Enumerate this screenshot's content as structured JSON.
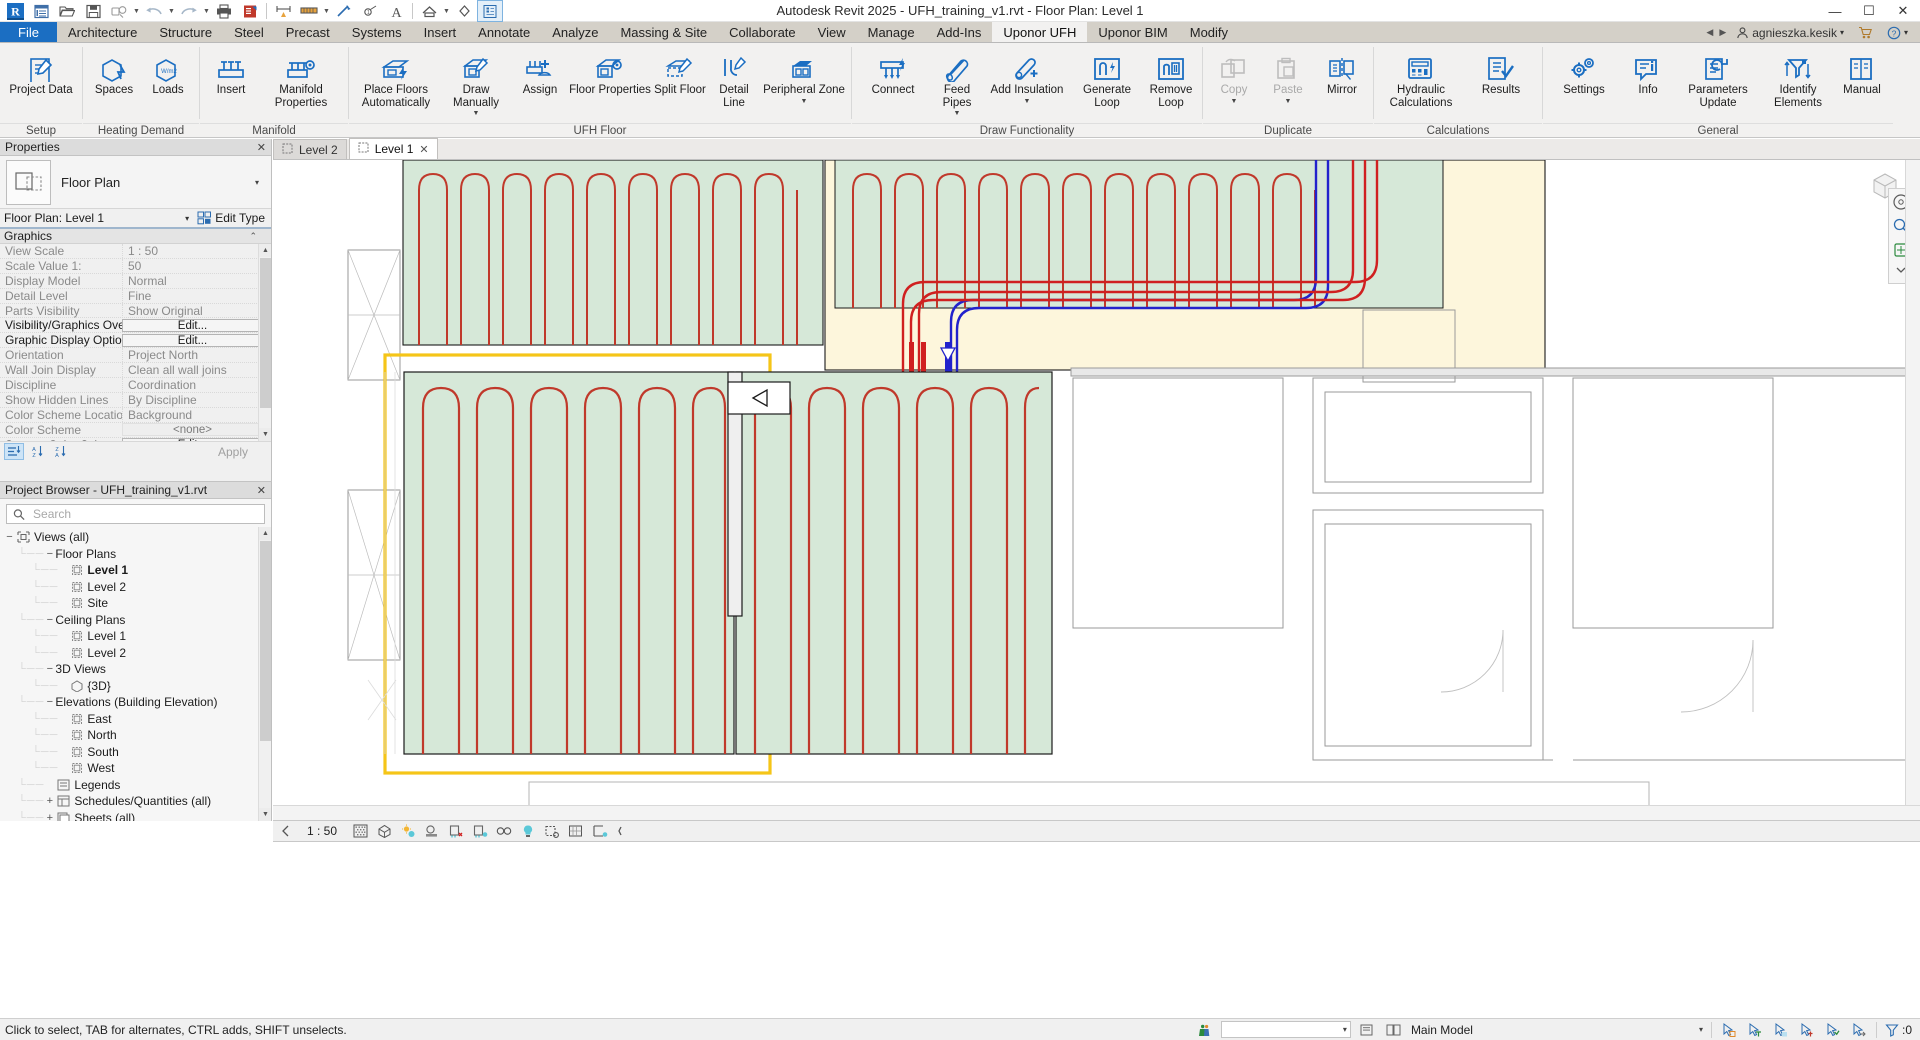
{
  "window": {
    "title": "Autodesk Revit 2025 - UFH_training_v1.rvt - Floor Plan: Level 1",
    "minimize": "—",
    "maximize": "☐",
    "close": "✕"
  },
  "quick_access": {
    "icons": [
      "revit-logo-icon",
      "project-data-icon",
      "open-icon",
      "save-icon",
      "sync-icon",
      "undo-icon",
      "redo-icon",
      "print-icon",
      "measure-icon",
      "aligned-dimension-icon",
      "tag-icon",
      "text-icon",
      "default-3d-view-icon",
      "section-icon",
      "thin-lines-icon"
    ]
  },
  "ribbon": {
    "file_tab": "File",
    "tabs": [
      "Architecture",
      "Structure",
      "Steel",
      "Precast",
      "Systems",
      "Insert",
      "Annotate",
      "Analyze",
      "Massing & Site",
      "Collaborate",
      "View",
      "Manage",
      "Add-Ins",
      "Uponor UFH",
      "Uponor BIM",
      "Modify"
    ],
    "active_tab": "Uponor UFH",
    "user": {
      "name": "agnieszka.kesik",
      "nav_left": "◀",
      "nav_right": "▶",
      "help": "?",
      "cart_icon": "cart-icon",
      "user_caret": "▾",
      "help_caret": "▾"
    },
    "panels": [
      {
        "title": "Setup",
        "buttons": [
          {
            "label": "Project\nData",
            "icon": "project-data-icon",
            "disabled": false,
            "caret": false
          }
        ]
      },
      {
        "title": "Heating Demand",
        "buttons": [
          {
            "label": "Spaces",
            "icon": "spaces-icon",
            "disabled": false,
            "caret": false
          },
          {
            "label": "Loads",
            "icon": "loads-icon",
            "disabled": false,
            "caret": false
          }
        ]
      },
      {
        "title": "Manifold",
        "buttons": [
          {
            "label": "Insert",
            "icon": "insert-manifold-icon",
            "disabled": false,
            "caret": false
          },
          {
            "label": "Manifold\nProperties",
            "icon": "manifold-properties-icon",
            "disabled": false,
            "caret": false
          }
        ]
      },
      {
        "title": "UFH Floor",
        "buttons": [
          {
            "label": "Place Floors\nAutomatically",
            "icon": "place-floors-automatically-icon",
            "disabled": false,
            "caret": false
          },
          {
            "label": "Draw\nManually",
            "icon": "draw-manually-icon",
            "disabled": false,
            "caret": true
          },
          {
            "label": "Assign",
            "icon": "assign-icon",
            "disabled": false,
            "caret": false
          },
          {
            "label": "Floor\nProperties",
            "icon": "floor-properties-icon",
            "disabled": false,
            "caret": false
          },
          {
            "label": "Split\nFloor",
            "icon": "split-floor-icon",
            "disabled": false,
            "caret": false
          },
          {
            "label": "Detail\nLine",
            "icon": "detail-line-icon",
            "disabled": false,
            "caret": false
          },
          {
            "label": "Peripheral\nZone",
            "icon": "peripheral-zone-icon",
            "disabled": false,
            "caret": true
          }
        ]
      },
      {
        "title": "Draw Functionality",
        "buttons": [
          {
            "label": "Connect",
            "icon": "connect-icon",
            "disabled": false,
            "caret": false
          },
          {
            "label": "Feed\nPipes",
            "icon": "feed-pipes-icon",
            "disabled": false,
            "caret": true
          },
          {
            "label": "Add\nInsulation",
            "icon": "add-insulation-icon",
            "disabled": false,
            "caret": true
          },
          {
            "label": "Generate\nLoop",
            "icon": "generate-loop-icon",
            "disabled": false,
            "caret": false
          },
          {
            "label": "Remove\nLoop",
            "icon": "remove-loop-icon",
            "disabled": false,
            "caret": false
          }
        ]
      },
      {
        "title": "Duplicate",
        "buttons": [
          {
            "label": "Copy",
            "icon": "copy-icon",
            "disabled": true,
            "caret": true
          },
          {
            "label": "Paste",
            "icon": "paste-icon",
            "disabled": true,
            "caret": true
          },
          {
            "label": "Mirror",
            "icon": "mirror-icon",
            "disabled": false,
            "caret": false
          }
        ]
      },
      {
        "title": "Calculations",
        "buttons": [
          {
            "label": "Hydraulic\nCalculations",
            "icon": "hydraulic-calculations-icon",
            "disabled": false,
            "caret": false
          },
          {
            "label": "Results",
            "icon": "results-icon",
            "disabled": false,
            "caret": false
          }
        ]
      },
      {
        "title": "General",
        "buttons": [
          {
            "label": "Settings",
            "icon": "settings-icon",
            "disabled": false,
            "caret": false
          },
          {
            "label": "Info",
            "icon": "info-icon",
            "disabled": false,
            "caret": false
          },
          {
            "label": "Parameters\nUpdate",
            "icon": "parameters-update-icon",
            "disabled": false,
            "caret": false
          },
          {
            "label": "Identify\nElements",
            "icon": "identify-elements-icon",
            "disabled": false,
            "caret": false
          },
          {
            "label": "Manual",
            "icon": "manual-icon",
            "disabled": false,
            "caret": false
          }
        ]
      }
    ]
  },
  "properties": {
    "panel_title": "Properties",
    "close": "✕",
    "type_name": "Floor Plan",
    "type_caret": "▾",
    "selector_value": "Floor Plan: Level 1",
    "selector_caret": "▾",
    "edit_type_label": "Edit Type",
    "group_label": "Graphics",
    "group_chevron": "⌃",
    "rows": [
      {
        "key": "View Scale",
        "value": "1 : 50",
        "kind": "text",
        "strong": false
      },
      {
        "key": "Scale Value     1:",
        "value": "50",
        "kind": "text",
        "strong": false
      },
      {
        "key": "Display Model",
        "value": "Normal",
        "kind": "text",
        "strong": false
      },
      {
        "key": "Detail Level",
        "value": "Fine",
        "kind": "text",
        "strong": false
      },
      {
        "key": "Parts Visibility",
        "value": "Show Original",
        "kind": "text",
        "strong": false
      },
      {
        "key": "Visibility/Graphics Overri...",
        "value": "Edit...",
        "kind": "button",
        "strong": true
      },
      {
        "key": "Graphic Display Options",
        "value": "Edit...",
        "kind": "button",
        "strong": true
      },
      {
        "key": "Orientation",
        "value": "Project North",
        "kind": "text",
        "strong": false
      },
      {
        "key": "Wall Join Display",
        "value": "Clean all wall joins",
        "kind": "text",
        "strong": false
      },
      {
        "key": "Discipline",
        "value": "Coordination",
        "kind": "text",
        "strong": false
      },
      {
        "key": "Show Hidden Lines",
        "value": "By Discipline",
        "kind": "text",
        "strong": false
      },
      {
        "key": "Color Scheme Location",
        "value": "Background",
        "kind": "text",
        "strong": false
      },
      {
        "key": "Color Scheme",
        "value": "<none>",
        "kind": "plain",
        "strong": false
      },
      {
        "key": "System Color Schemes",
        "value": "Edit...",
        "kind": "button",
        "strong": true
      }
    ],
    "footer": {
      "sort_group_icon": "sort-group-icon",
      "sort_asc_icon": "sort-ascending-icon",
      "sort_desc_icon": "sort-descending-icon",
      "apply_label": "Apply"
    }
  },
  "project_browser": {
    "panel_title": "Project Browser - UFH_training_v1.rvt",
    "close": "✕",
    "search_placeholder": "Search",
    "search_value": "",
    "tree": [
      {
        "label": "Views (all)",
        "depth": 0,
        "toggle": "−",
        "icon": "views-icon",
        "bold": false
      },
      {
        "label": "Floor Plans",
        "depth": 1,
        "toggle": "−",
        "icon": "",
        "bold": false
      },
      {
        "label": "Level 1",
        "depth": 2,
        "toggle": "",
        "icon": "plan-view-icon",
        "bold": true
      },
      {
        "label": "Level 2",
        "depth": 2,
        "toggle": "",
        "icon": "plan-view-icon",
        "bold": false
      },
      {
        "label": "Site",
        "depth": 2,
        "toggle": "",
        "icon": "plan-view-icon",
        "bold": false
      },
      {
        "label": "Ceiling Plans",
        "depth": 1,
        "toggle": "−",
        "icon": "",
        "bold": false
      },
      {
        "label": "Level 1",
        "depth": 2,
        "toggle": "",
        "icon": "plan-view-icon",
        "bold": false
      },
      {
        "label": "Level 2",
        "depth": 2,
        "toggle": "",
        "icon": "plan-view-icon",
        "bold": false
      },
      {
        "label": "3D Views",
        "depth": 1,
        "toggle": "−",
        "icon": "",
        "bold": false
      },
      {
        "label": "{3D}",
        "depth": 2,
        "toggle": "",
        "icon": "3d-view-icon",
        "bold": false
      },
      {
        "label": "Elevations (Building Elevation)",
        "depth": 1,
        "toggle": "−",
        "icon": "",
        "bold": false
      },
      {
        "label": "East",
        "depth": 2,
        "toggle": "",
        "icon": "elevation-view-icon",
        "bold": false
      },
      {
        "label": "North",
        "depth": 2,
        "toggle": "",
        "icon": "elevation-view-icon",
        "bold": false
      },
      {
        "label": "South",
        "depth": 2,
        "toggle": "",
        "icon": "elevation-view-icon",
        "bold": false
      },
      {
        "label": "West",
        "depth": 2,
        "toggle": "",
        "icon": "elevation-view-icon",
        "bold": false
      },
      {
        "label": "Legends",
        "depth": 1,
        "toggle": "",
        "icon": "legends-icon",
        "bold": false
      },
      {
        "label": "Schedules/Quantities (all)",
        "depth": 1,
        "toggle": "+",
        "icon": "schedules-icon",
        "bold": false
      },
      {
        "label": "Sheets (all)",
        "depth": 1,
        "toggle": "+",
        "icon": "sheets-icon",
        "bold": false
      }
    ]
  },
  "view_tabs": {
    "tabs": [
      {
        "label": "Level 2",
        "active": false,
        "close": ""
      },
      {
        "label": "Level 1",
        "active": true,
        "close": "✕"
      }
    ]
  },
  "view_control_bar": {
    "scale": "1 : 50",
    "icons": [
      "detail-level-fine-icon",
      "visual-style-icon",
      "sun-path-icon",
      "shadows-icon",
      "render-dialog-icon",
      "crop-view-icon",
      "show-crop-region-icon",
      "lightbulb-icon",
      "temporary-hide-isolate-icon",
      "reveal-hidden-elements-icon",
      "analytical-model-icon",
      "constraints-icon",
      "collapse-icon"
    ]
  },
  "status_bar": {
    "message": "Click to select, TAB for alternates, CTRL adds, SHIFT unselects.",
    "worksets_icon": "worksets-icon",
    "design_options_value": "",
    "design_options_caret": "▾",
    "exclude_options_icon": "exclude-options-icon",
    "editing_requests_icon": "editing-requests-icon",
    "main_model": "Main Model",
    "main_model_caret": "▾",
    "filter_count": ":0",
    "selection_count": ":0",
    "right_icons": [
      "press-pick-icon",
      "select-links-icon",
      "select-underlay-icon",
      "select-pinned-icon",
      "select-face-icon",
      "drag-element-icon"
    ]
  },
  "canvas": {
    "scale_note": "1 : 50",
    "colors": {
      "ufh_zone_fill": "#d6e8d8",
      "ufh_pipe_red": "#c0392b",
      "feed_pipe_blue": "#2222cc",
      "feed_pipe_red": "#d02020",
      "selection_yellow": "#f5c518",
      "peripheral_fill": "#fdf6dc",
      "wall_gray": "#7d7d7d"
    }
  }
}
